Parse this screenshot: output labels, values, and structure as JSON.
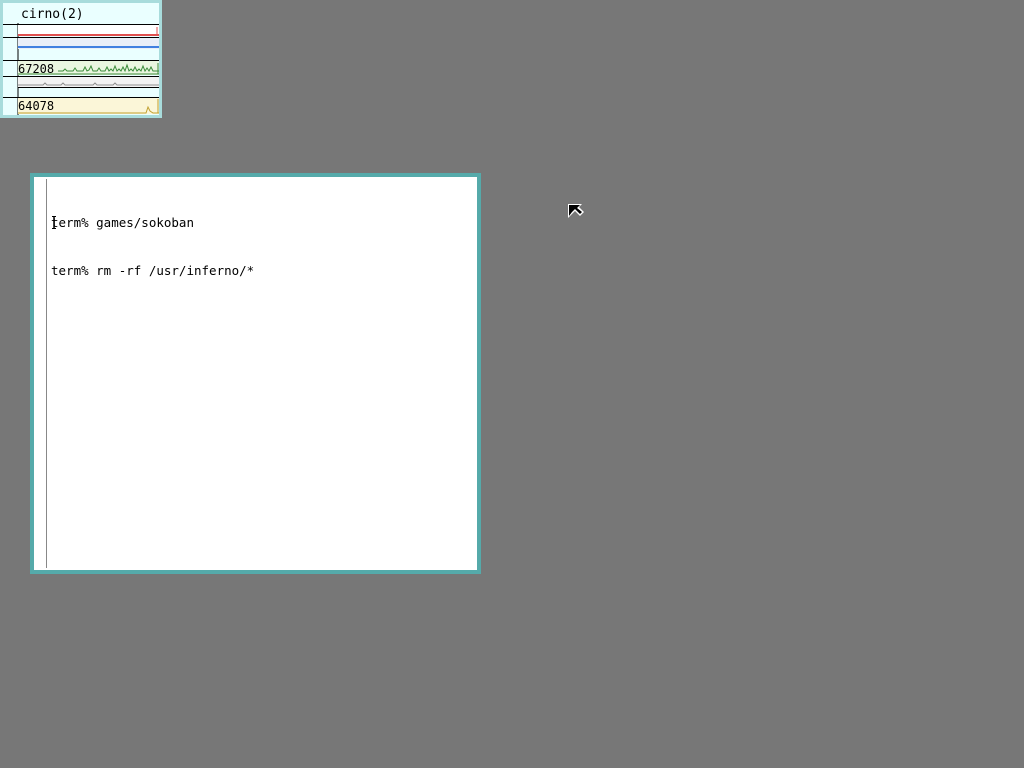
{
  "stats_window": {
    "title": "cirno(2)",
    "meters": [
      {
        "value_label": "",
        "color": "#e05050",
        "level": 0.1
      },
      {
        "value_label": "",
        "color": "#4080e0",
        "level": 0.1
      },
      {
        "value_label": "67208",
        "color": "#3a8a3a"
      },
      {
        "value_label": "",
        "color": "#909090"
      },
      {
        "value_label": "64078",
        "color": "#c0a030"
      }
    ]
  },
  "terminal": {
    "lines": [
      "term% games/sokoban",
      "term% rm -rf /usr/inferno/*"
    ]
  },
  "pointer": {
    "icon": "arrow-pointer-icon"
  }
}
